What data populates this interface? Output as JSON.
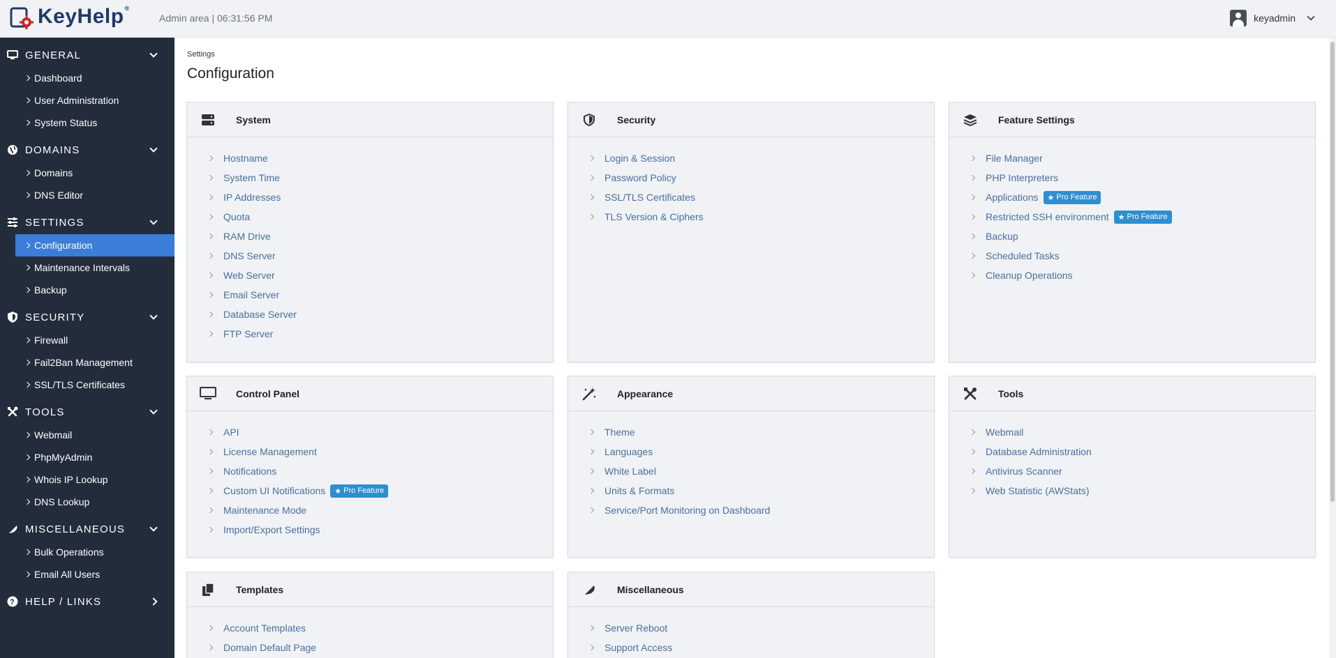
{
  "header": {
    "logo_text": "KeyHelp",
    "logo_reg": "®",
    "info": "Admin area | 06:31:56 PM",
    "username": "keyadmin"
  },
  "sidebar": {
    "sections": [
      {
        "title": "GENERAL",
        "icon": "monitor-icon",
        "items": [
          "Dashboard",
          "User Administration",
          "System Status"
        ]
      },
      {
        "title": "DOMAINS",
        "icon": "globe-icon",
        "items": [
          "Domains",
          "DNS Editor"
        ]
      },
      {
        "title": "SETTINGS",
        "icon": "sliders-icon",
        "items": [
          "Configuration",
          "Maintenance Intervals",
          "Backup"
        ]
      },
      {
        "title": "SECURITY",
        "icon": "shield-icon",
        "items": [
          "Firewall",
          "Fail2Ban Management",
          "SSL/TLS Certificates"
        ]
      },
      {
        "title": "TOOLS",
        "icon": "tools-icon",
        "items": [
          "Webmail",
          "PhpMyAdmin",
          "Whois IP Lookup",
          "DNS Lookup"
        ]
      },
      {
        "title": "MISCELLANEOUS",
        "icon": "feather-icon",
        "items": [
          "Bulk Operations",
          "Email All Users"
        ]
      },
      {
        "title": "HELP / LINKS",
        "icon": "help-icon",
        "items": []
      }
    ],
    "active_item": "Configuration"
  },
  "page": {
    "breadcrumb": "Settings",
    "title": "Configuration"
  },
  "pro_label": "Pro Feature",
  "cards": [
    {
      "title": "System",
      "icon": "server-icon",
      "items": [
        {
          "label": "Hostname"
        },
        {
          "label": "System Time"
        },
        {
          "label": "IP Addresses"
        },
        {
          "label": "Quota"
        },
        {
          "label": "RAM Drive"
        },
        {
          "label": "DNS Server"
        },
        {
          "label": "Web Server"
        },
        {
          "label": "Email Server"
        },
        {
          "label": "Database Server"
        },
        {
          "label": "FTP Server"
        }
      ]
    },
    {
      "title": "Security",
      "icon": "shield-half-icon",
      "items": [
        {
          "label": "Login & Session"
        },
        {
          "label": "Password Policy"
        },
        {
          "label": "SSL/TLS Certificates"
        },
        {
          "label": "TLS Version & Ciphers"
        }
      ]
    },
    {
      "title": "Feature Settings",
      "icon": "layers-icon",
      "items": [
        {
          "label": "File Manager"
        },
        {
          "label": "PHP Interpreters"
        },
        {
          "label": "Applications",
          "pro": true
        },
        {
          "label": "Restricted SSH environment",
          "pro": true
        },
        {
          "label": "Backup"
        },
        {
          "label": "Scheduled Tasks"
        },
        {
          "label": "Cleanup Operations"
        }
      ]
    },
    {
      "title": "Control Panel",
      "icon": "desktop-icon",
      "items": [
        {
          "label": "API"
        },
        {
          "label": "License Management"
        },
        {
          "label": "Notifications"
        },
        {
          "label": "Custom UI Notifications",
          "pro": true
        },
        {
          "label": "Maintenance Mode"
        },
        {
          "label": "Import/Export Settings"
        }
      ]
    },
    {
      "title": "Appearance",
      "icon": "magic-wand-icon",
      "items": [
        {
          "label": "Theme"
        },
        {
          "label": "Languages"
        },
        {
          "label": "White Label"
        },
        {
          "label": "Units & Formats"
        },
        {
          "label": "Service/Port Monitoring on Dashboard"
        }
      ]
    },
    {
      "title": "Tools",
      "icon": "tools-icon",
      "items": [
        {
          "label": "Webmail"
        },
        {
          "label": "Database Administration"
        },
        {
          "label": "Antivirus Scanner"
        },
        {
          "label": "Web Statistic (AWStats)"
        }
      ]
    },
    {
      "title": "Templates",
      "icon": "copy-icon",
      "items": [
        {
          "label": "Account Templates"
        },
        {
          "label": "Domain Default Page"
        }
      ]
    },
    {
      "title": "Miscellaneous",
      "icon": "feather-icon",
      "items": [
        {
          "label": "Server Reboot"
        },
        {
          "label": "Support Access"
        }
      ]
    }
  ],
  "colors": {
    "sidebar_bg": "#222c3a",
    "active_bg": "#3b7dd8",
    "link": "#4a6f9a",
    "pro_badge": "#2e8fd0"
  }
}
